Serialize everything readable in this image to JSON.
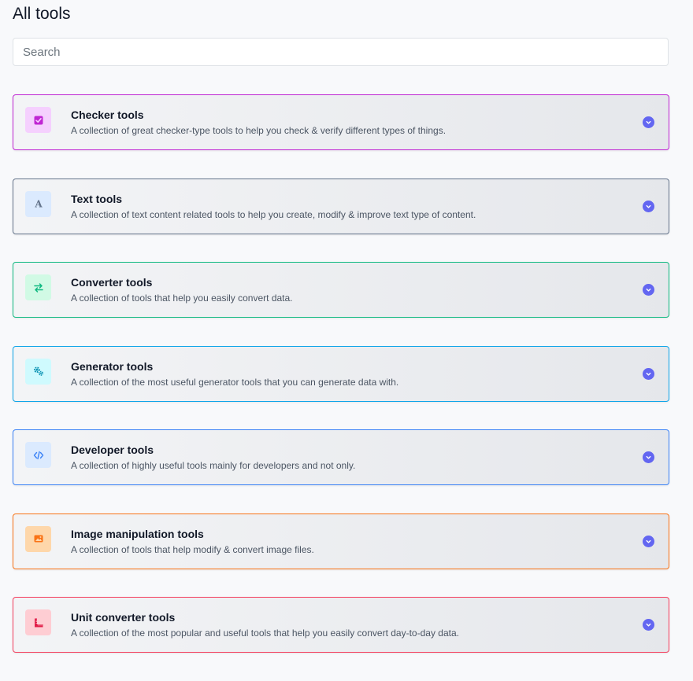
{
  "page": {
    "title": "All tools"
  },
  "search": {
    "placeholder": "Search",
    "value": ""
  },
  "colors": {
    "chevron": "#6366f1"
  },
  "categories": [
    {
      "title": "Checker tools",
      "description": "A collection of great checker-type tools to help you check & verify different types of things.",
      "icon": "checkbox-icon",
      "border": "#c026d3",
      "icon_bg": "#f5d0fe",
      "icon_fg": "#c026d3"
    },
    {
      "title": "Text tools",
      "description": "A collection of text content related tools to help you create, modify & improve text type of content.",
      "icon": "letter-a-icon",
      "border": "#64748b",
      "icon_bg": "#dbeafe",
      "icon_fg": "#64748b"
    },
    {
      "title": "Converter tools",
      "description": "A collection of tools that help you easily convert data.",
      "icon": "arrows-exchange-icon",
      "border": "#10b981",
      "icon_bg": "#d1fae5",
      "icon_fg": "#10b981"
    },
    {
      "title": "Generator tools",
      "description": "A collection of the most useful generator tools that you can generate data with.",
      "icon": "cogs-icon",
      "border": "#0ea5e9",
      "icon_bg": "#cffafe",
      "icon_fg": "#0891b2"
    },
    {
      "title": "Developer tools",
      "description": "A collection of highly useful tools mainly for developers and not only.",
      "icon": "code-icon",
      "border": "#3b82f6",
      "icon_bg": "#dbeafe",
      "icon_fg": "#3b82f6"
    },
    {
      "title": "Image manipulation tools",
      "description": "A collection of tools that help modify & convert image files.",
      "icon": "image-icon",
      "border": "#f97316",
      "icon_bg": "#fed7aa",
      "icon_fg": "#f97316"
    },
    {
      "title": "Unit converter tools",
      "description": "A collection of the most popular and useful tools that help you easily convert day-to-day data.",
      "icon": "ruler-icon",
      "border": "#f43f5e",
      "icon_bg": "#fecdd3",
      "icon_fg": "#e11d48"
    }
  ]
}
